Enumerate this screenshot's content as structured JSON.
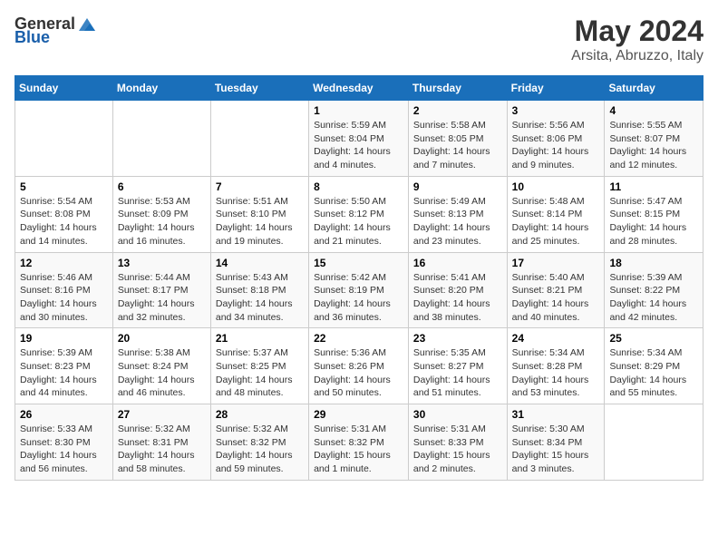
{
  "header": {
    "logo_general": "General",
    "logo_blue": "Blue",
    "title": "May 2024",
    "subtitle": "Arsita, Abruzzo, Italy"
  },
  "weekdays": [
    "Sunday",
    "Monday",
    "Tuesday",
    "Wednesday",
    "Thursday",
    "Friday",
    "Saturday"
  ],
  "weeks": [
    [
      {
        "day": "",
        "info": ""
      },
      {
        "day": "",
        "info": ""
      },
      {
        "day": "",
        "info": ""
      },
      {
        "day": "1",
        "info": "Sunrise: 5:59 AM\nSunset: 8:04 PM\nDaylight: 14 hours\nand 4 minutes."
      },
      {
        "day": "2",
        "info": "Sunrise: 5:58 AM\nSunset: 8:05 PM\nDaylight: 14 hours\nand 7 minutes."
      },
      {
        "day": "3",
        "info": "Sunrise: 5:56 AM\nSunset: 8:06 PM\nDaylight: 14 hours\nand 9 minutes."
      },
      {
        "day": "4",
        "info": "Sunrise: 5:55 AM\nSunset: 8:07 PM\nDaylight: 14 hours\nand 12 minutes."
      }
    ],
    [
      {
        "day": "5",
        "info": "Sunrise: 5:54 AM\nSunset: 8:08 PM\nDaylight: 14 hours\nand 14 minutes."
      },
      {
        "day": "6",
        "info": "Sunrise: 5:53 AM\nSunset: 8:09 PM\nDaylight: 14 hours\nand 16 minutes."
      },
      {
        "day": "7",
        "info": "Sunrise: 5:51 AM\nSunset: 8:10 PM\nDaylight: 14 hours\nand 19 minutes."
      },
      {
        "day": "8",
        "info": "Sunrise: 5:50 AM\nSunset: 8:12 PM\nDaylight: 14 hours\nand 21 minutes."
      },
      {
        "day": "9",
        "info": "Sunrise: 5:49 AM\nSunset: 8:13 PM\nDaylight: 14 hours\nand 23 minutes."
      },
      {
        "day": "10",
        "info": "Sunrise: 5:48 AM\nSunset: 8:14 PM\nDaylight: 14 hours\nand 25 minutes."
      },
      {
        "day": "11",
        "info": "Sunrise: 5:47 AM\nSunset: 8:15 PM\nDaylight: 14 hours\nand 28 minutes."
      }
    ],
    [
      {
        "day": "12",
        "info": "Sunrise: 5:46 AM\nSunset: 8:16 PM\nDaylight: 14 hours\nand 30 minutes."
      },
      {
        "day": "13",
        "info": "Sunrise: 5:44 AM\nSunset: 8:17 PM\nDaylight: 14 hours\nand 32 minutes."
      },
      {
        "day": "14",
        "info": "Sunrise: 5:43 AM\nSunset: 8:18 PM\nDaylight: 14 hours\nand 34 minutes."
      },
      {
        "day": "15",
        "info": "Sunrise: 5:42 AM\nSunset: 8:19 PM\nDaylight: 14 hours\nand 36 minutes."
      },
      {
        "day": "16",
        "info": "Sunrise: 5:41 AM\nSunset: 8:20 PM\nDaylight: 14 hours\nand 38 minutes."
      },
      {
        "day": "17",
        "info": "Sunrise: 5:40 AM\nSunset: 8:21 PM\nDaylight: 14 hours\nand 40 minutes."
      },
      {
        "day": "18",
        "info": "Sunrise: 5:39 AM\nSunset: 8:22 PM\nDaylight: 14 hours\nand 42 minutes."
      }
    ],
    [
      {
        "day": "19",
        "info": "Sunrise: 5:39 AM\nSunset: 8:23 PM\nDaylight: 14 hours\nand 44 minutes."
      },
      {
        "day": "20",
        "info": "Sunrise: 5:38 AM\nSunset: 8:24 PM\nDaylight: 14 hours\nand 46 minutes."
      },
      {
        "day": "21",
        "info": "Sunrise: 5:37 AM\nSunset: 8:25 PM\nDaylight: 14 hours\nand 48 minutes."
      },
      {
        "day": "22",
        "info": "Sunrise: 5:36 AM\nSunset: 8:26 PM\nDaylight: 14 hours\nand 50 minutes."
      },
      {
        "day": "23",
        "info": "Sunrise: 5:35 AM\nSunset: 8:27 PM\nDaylight: 14 hours\nand 51 minutes."
      },
      {
        "day": "24",
        "info": "Sunrise: 5:34 AM\nSunset: 8:28 PM\nDaylight: 14 hours\nand 53 minutes."
      },
      {
        "day": "25",
        "info": "Sunrise: 5:34 AM\nSunset: 8:29 PM\nDaylight: 14 hours\nand 55 minutes."
      }
    ],
    [
      {
        "day": "26",
        "info": "Sunrise: 5:33 AM\nSunset: 8:30 PM\nDaylight: 14 hours\nand 56 minutes."
      },
      {
        "day": "27",
        "info": "Sunrise: 5:32 AM\nSunset: 8:31 PM\nDaylight: 14 hours\nand 58 minutes."
      },
      {
        "day": "28",
        "info": "Sunrise: 5:32 AM\nSunset: 8:32 PM\nDaylight: 14 hours\nand 59 minutes."
      },
      {
        "day": "29",
        "info": "Sunrise: 5:31 AM\nSunset: 8:32 PM\nDaylight: 15 hours\nand 1 minute."
      },
      {
        "day": "30",
        "info": "Sunrise: 5:31 AM\nSunset: 8:33 PM\nDaylight: 15 hours\nand 2 minutes."
      },
      {
        "day": "31",
        "info": "Sunrise: 5:30 AM\nSunset: 8:34 PM\nDaylight: 15 hours\nand 3 minutes."
      },
      {
        "day": "",
        "info": ""
      }
    ]
  ]
}
